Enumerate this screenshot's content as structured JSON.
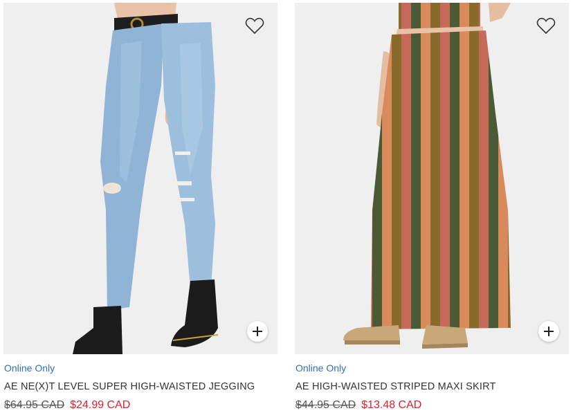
{
  "colors": {
    "badge": "#2f6fb0",
    "sale_price": "#e0202a",
    "title_text": "#333333",
    "image_bg": "#efefef"
  },
  "icons": {
    "favorite": "heart-outline-icon",
    "quick_add": "plus-icon"
  },
  "products": [
    {
      "badge": "Online Only",
      "title": "AE NE(X)T LEVEL SUPER HIGH-WAISTED JEGGING",
      "original_price": "$64.95 CAD",
      "sale_price": "$24.99 CAD"
    },
    {
      "badge": "Online Only",
      "title": "AE HIGH-WAISTED STRIPED MAXI SKIRT",
      "original_price": "$44.95 CAD",
      "sale_price": "$13.48 CAD"
    }
  ]
}
